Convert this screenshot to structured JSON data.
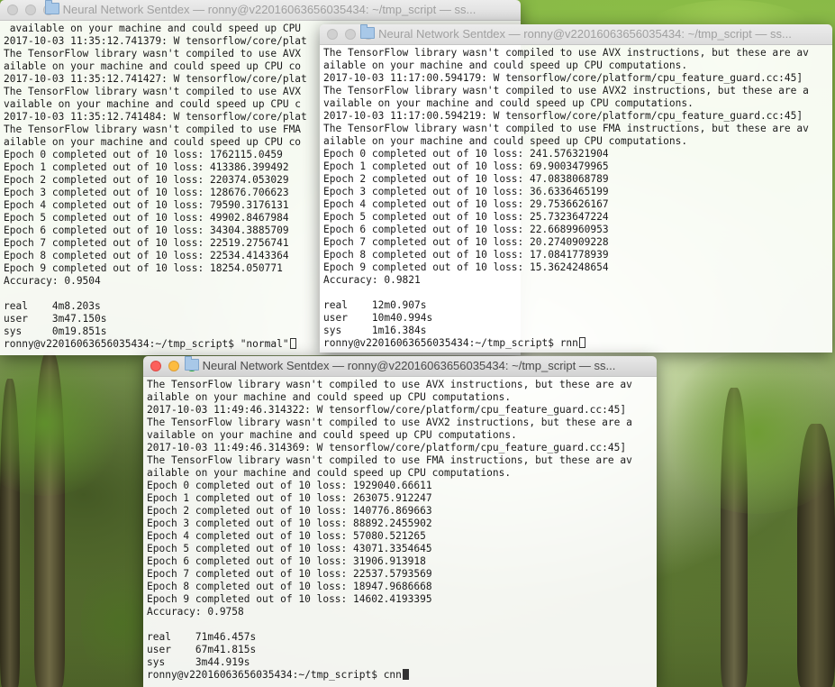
{
  "windows": [
    {
      "title": "Neural Network Sentdex — ronny@v22016063656035434: ~/tmp_script — ss...",
      "lines": [
        " available on your machine and could speed up CPU",
        "2017-10-03 11:35:12.741379: W tensorflow/core/plat",
        "The TensorFlow library wasn't compiled to use AVX",
        "ailable on your machine and could speed up CPU co",
        "2017-10-03 11:35:12.741427: W tensorflow/core/plat",
        "The TensorFlow library wasn't compiled to use AVX",
        "vailable on your machine and could speed up CPU c",
        "2017-10-03 11:35:12.741484: W tensorflow/core/plat",
        "The TensorFlow library wasn't compiled to use FMA",
        "ailable on your machine and could speed up CPU co",
        "Epoch 0 completed out of 10 loss: 1762115.0459",
        "Epoch 1 completed out of 10 loss: 413386.399492",
        "Epoch 2 completed out of 10 loss: 220374.053029",
        "Epoch 3 completed out of 10 loss: 128676.706623",
        "Epoch 4 completed out of 10 loss: 79590.3176131",
        "Epoch 5 completed out of 10 loss: 49902.8467984",
        "Epoch 6 completed out of 10 loss: 34304.3885709",
        "Epoch 7 completed out of 10 loss: 22519.2756741",
        "Epoch 8 completed out of 10 loss: 22534.4143364",
        "Epoch 9 completed out of 10 loss: 18254.050771",
        "Accuracy: 0.9504",
        "",
        "real    4m8.203s",
        "user    3m47.150s",
        "sys     0m19.851s"
      ],
      "prompt": "ronny@v22016063656035434:~/tmp_script$ ",
      "command": "\"normal\""
    },
    {
      "title": "Neural Network Sentdex — ronny@v22016063656035434: ~/tmp_script — ss...",
      "lines": [
        "The TensorFlow library wasn't compiled to use AVX instructions, but these are av",
        "ailable on your machine and could speed up CPU computations.",
        "2017-10-03 11:17:00.594179: W tensorflow/core/platform/cpu_feature_guard.cc:45]",
        "The TensorFlow library wasn't compiled to use AVX2 instructions, but these are a",
        "vailable on your machine and could speed up CPU computations.",
        "2017-10-03 11:17:00.594219: W tensorflow/core/platform/cpu_feature_guard.cc:45]",
        "The TensorFlow library wasn't compiled to use FMA instructions, but these are av",
        "ailable on your machine and could speed up CPU computations.",
        "Epoch 0 completed out of 10 loss: 241.576321904",
        "Epoch 1 completed out of 10 loss: 69.9003479965",
        "Epoch 2 completed out of 10 loss: 47.0838068789",
        "Epoch 3 completed out of 10 loss: 36.6336465199",
        "Epoch 4 completed out of 10 loss: 29.7536626167",
        "Epoch 5 completed out of 10 loss: 25.7323647224",
        "Epoch 6 completed out of 10 loss: 22.6689960953",
        "Epoch 7 completed out of 10 loss: 20.2740909228",
        "Epoch 8 completed out of 10 loss: 17.0841778939",
        "Epoch 9 completed out of 10 loss: 15.3624248654",
        "Accuracy: 0.9821",
        "",
        "real    12m0.907s",
        "user    10m40.994s",
        "sys     1m16.384s"
      ],
      "prompt": "ronny@v22016063656035434:~/tmp_script$ ",
      "command": "rnn"
    },
    {
      "title": "Neural Network Sentdex — ronny@v22016063656035434: ~/tmp_script — ss...",
      "lines": [
        "The TensorFlow library wasn't compiled to use AVX instructions, but these are av",
        "ailable on your machine and could speed up CPU computations.",
        "2017-10-03 11:49:46.314322: W tensorflow/core/platform/cpu_feature_guard.cc:45]",
        "The TensorFlow library wasn't compiled to use AVX2 instructions, but these are a",
        "vailable on your machine and could speed up CPU computations.",
        "2017-10-03 11:49:46.314369: W tensorflow/core/platform/cpu_feature_guard.cc:45]",
        "The TensorFlow library wasn't compiled to use FMA instructions, but these are av",
        "ailable on your machine and could speed up CPU computations.",
        "Epoch 0 completed out of 10 loss: 1929040.66611",
        "Epoch 1 completed out of 10 loss: 263075.912247",
        "Epoch 2 completed out of 10 loss: 140776.869663",
        "Epoch 3 completed out of 10 loss: 88892.2455902",
        "Epoch 4 completed out of 10 loss: 57080.521265",
        "Epoch 5 completed out of 10 loss: 43071.3354645",
        "Epoch 6 completed out of 10 loss: 31906.913918",
        "Epoch 7 completed out of 10 loss: 22537.5793569",
        "Epoch 8 completed out of 10 loss: 18947.9686668",
        "Epoch 9 completed out of 10 loss: 14602.4193395",
        "Accuracy: 0.9758",
        "",
        "real    71m46.457s",
        "user    67m41.815s",
        "sys     3m44.919s"
      ],
      "prompt": "ronny@v22016063656035434:~/tmp_script$ ",
      "command": "cnn"
    }
  ]
}
